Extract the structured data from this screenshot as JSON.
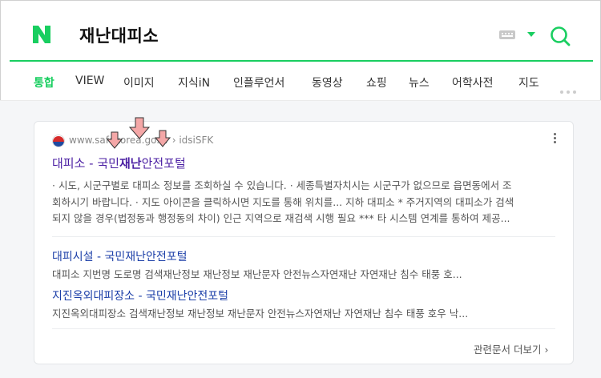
{
  "header": {
    "logo_letter": "N",
    "query": "재난대피소"
  },
  "tabs": [
    "통합",
    "VIEW",
    "이미지",
    "지식iN",
    "인플루언서",
    "동영상",
    "쇼핑",
    "뉴스",
    "어학사전",
    "지도"
  ],
  "result": {
    "source_url": "www.safekorea.go.kr › idsiSFK",
    "title_prefix": "대피소 - 국민",
    "title_bold": "재난",
    "title_suffix": "안전포털",
    "description": [
      "· 시도, 시군구별로 대피소 정보를 조회하실 수 있습니다. · 세종특별자치시는 시군구가 없으므로 읍면동에서 조",
      "회하시기 바랍니다. · 지도 아이콘을 클릭하시면 지도를 통해 위치를... 지하 대피소 * 주거지역의 대피소가 검색",
      "되지 않을 경우(법정동과 행정동의 차이) 인근 지역으로 재검색 시행 필요 *** 타 시스템 연계를 통하여 제공..."
    ],
    "sublinks": [
      {
        "title": "대피시설 - 국민재난안전포털",
        "description": "대피소 지번명 도로명 검색재난정보 재난정보 재난문자 안전뉴스자연재난 자연재난 침수 태풍 호..."
      },
      {
        "title": "지진옥외대피장소 - 국민재난안전포털",
        "description": "지진옥외대피장소 검색재난정보 재난정보 재난문자 안전뉴스자연재난 자연재난 침수 태풍 호우 낙..."
      }
    ],
    "more_label": "관련문서 더보기 ›"
  },
  "colors": {
    "brand_green": "#19ce60",
    "title_purple": "#4b1fa3",
    "link_blue": "#1c3fa8",
    "annotation_arrow": "#f4a7a7"
  }
}
